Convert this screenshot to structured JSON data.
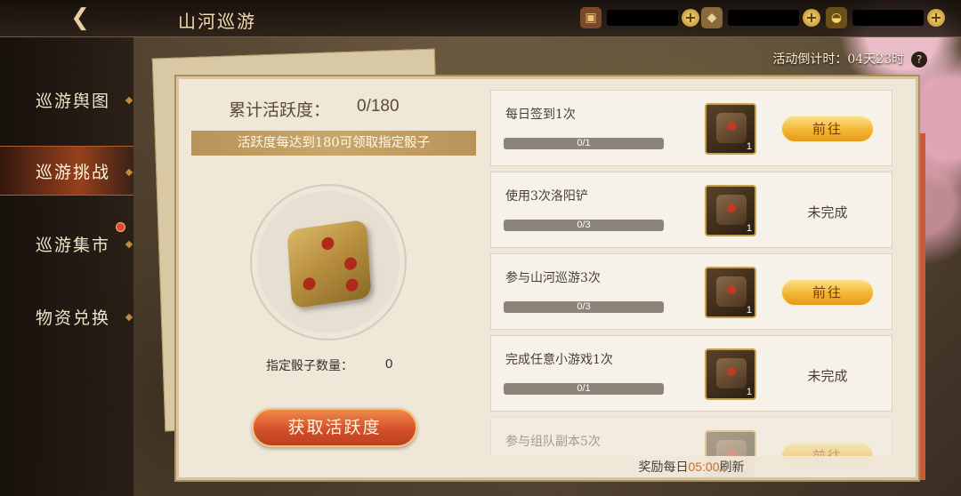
{
  "header": {
    "title": "山河巡游",
    "countdown_label": "活动倒计时：04天23时"
  },
  "currencies": [
    {
      "icon": "chest-icon",
      "value": ""
    },
    {
      "icon": "ore-icon",
      "value": ""
    },
    {
      "icon": "gold-ingot-icon",
      "value": ""
    }
  ],
  "sidebar": {
    "items": [
      {
        "label": "巡游舆图",
        "active": false
      },
      {
        "label": "巡游挑战",
        "active": true
      },
      {
        "label": "巡游集市",
        "active": false,
        "badge": true
      },
      {
        "label": "物资兑换",
        "active": false
      }
    ]
  },
  "left_panel": {
    "activity_label": "累计活跃度：",
    "activity_value": "0/180",
    "notice": "活跃度每达到180可领取指定骰子",
    "dice_count_label": "指定骰子数量：",
    "dice_count_value": "0",
    "get_button": "获取活跃度"
  },
  "tasks": [
    {
      "title": "每日签到1次",
      "progress": "0/1",
      "reward_qty": "1",
      "action": "前往",
      "action_type": "button"
    },
    {
      "title": "使用3次洛阳铲",
      "progress": "0/3",
      "reward_qty": "1",
      "action": "未完成",
      "action_type": "text"
    },
    {
      "title": "参与山河巡游3次",
      "progress": "0/3",
      "reward_qty": "1",
      "action": "前往",
      "action_type": "button"
    },
    {
      "title": "完成任意小游戏1次",
      "progress": "0/1",
      "reward_qty": "1",
      "action": "未完成",
      "action_type": "text"
    },
    {
      "title": "参与组队副本5次",
      "progress": "",
      "reward_qty": "",
      "action": "前往",
      "action_type": "button"
    }
  ],
  "footer": {
    "prefix": "奖励每日",
    "time": "05:00",
    "suffix": "刷新"
  }
}
